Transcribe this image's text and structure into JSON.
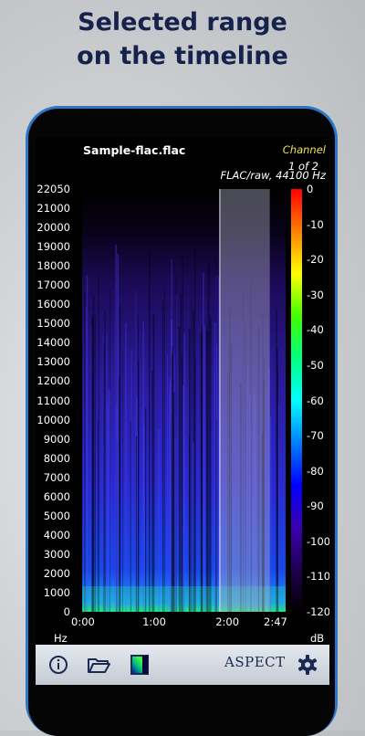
{
  "headline": {
    "line1": "Selected range",
    "line2": "on the timeline"
  },
  "app": {
    "file_name": "Sample-flac.flac",
    "channel_label": "Channel",
    "channel_page": "1 of 2",
    "format_info": "FLAC/raw, 44100 Hz"
  },
  "chart_data": {
    "type": "heatmap",
    "title": "Sample-flac.flac",
    "subtitle": "FLAC/raw, 44100 Hz",
    "xlabel": "",
    "ylabel": "Hz",
    "x_ticks": [
      "0:00",
      "1:00",
      "2:00",
      "2:47"
    ],
    "x_range_seconds": [
      0,
      167
    ],
    "y_ticks": [
      "22050",
      "21000",
      "20000",
      "19000",
      "18000",
      "17000",
      "16000",
      "15000",
      "14000",
      "13000",
      "12000",
      "11000",
      "10000",
      "9000",
      "8000",
      "7000",
      "6000",
      "5000",
      "4000",
      "3000",
      "2000",
      "1000",
      "0"
    ],
    "ylim": [
      0,
      22050
    ],
    "selected_range_seconds": [
      113,
      154
    ],
    "colorbar": {
      "label": "dB",
      "ticks": [
        "0",
        "-10",
        "-20",
        "-30",
        "-40",
        "-50",
        "-60",
        "-70",
        "-80",
        "-90",
        "-100",
        "-110",
        "-120"
      ],
      "range_db": [
        -120,
        0
      ],
      "colors": [
        "#ff0000",
        "#ff8000",
        "#ffff00",
        "#40ff00",
        "#00ff80",
        "#00ffff",
        "#0080ff",
        "#0000ff",
        "#3a00b0",
        "#200050",
        "#000000"
      ]
    }
  },
  "toolbar": {
    "info_icon": "info-icon",
    "folder_icon": "folder-open-icon",
    "palette_icon": "palette-icon",
    "brand": "ASPECT",
    "settings_icon": "gear-icon",
    "accent": "#1a2a55"
  }
}
